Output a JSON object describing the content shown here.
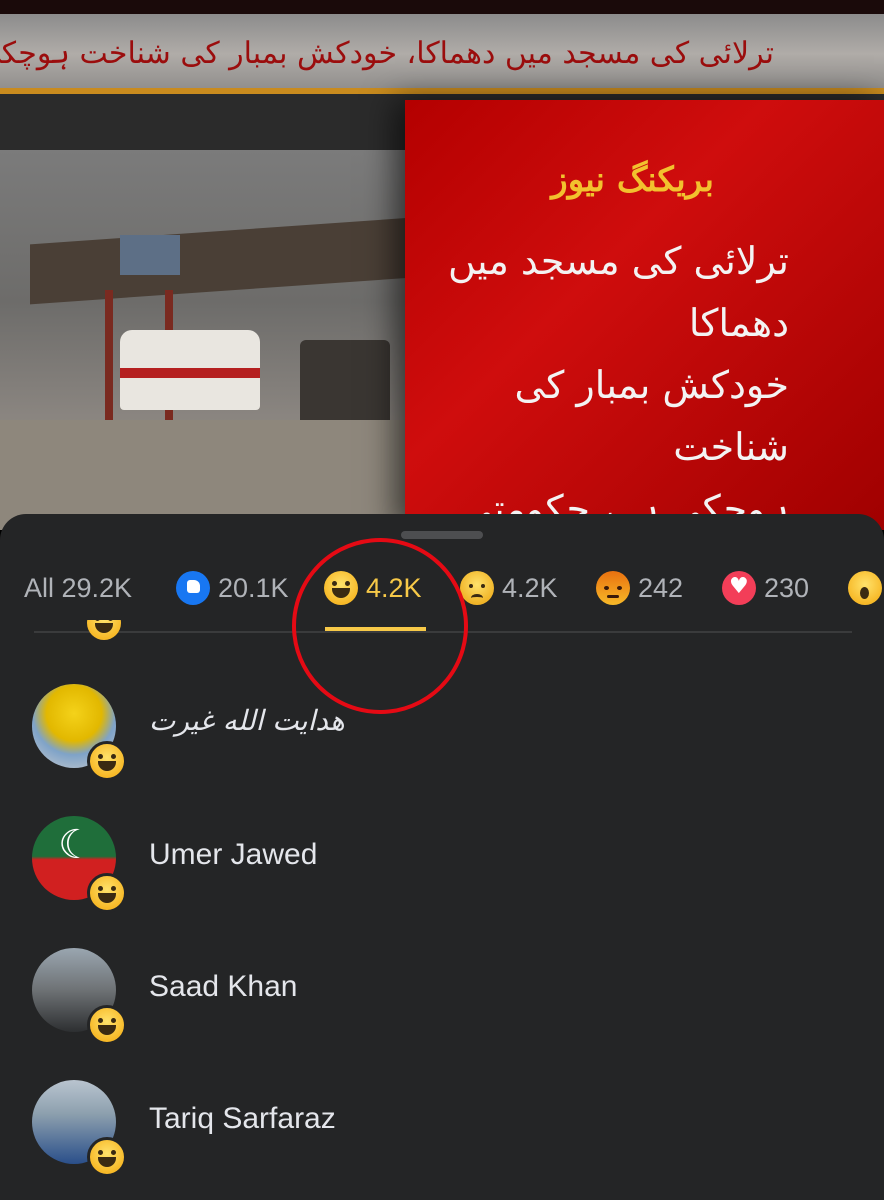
{
  "news": {
    "headline": "ترلائی کی مسجد میں دھماکا، خودکش بمبار کی شناخت ہوچکی ہے، حکومتی ذرائع",
    "breaking_label": "بریکنگ نیوز",
    "panel_lines": [
      "ترلائی کی مسجد میں دھماکا",
      "خودکش بمبار کی شناخت",
      "ہوچکی ہے، حکومتی ذرائع"
    ]
  },
  "reactions_tabs": [
    {
      "label": "All 29.2K"
    },
    {
      "icon": "like-icon",
      "count": "20.1K"
    },
    {
      "icon": "haha-icon",
      "count": "4.2K",
      "active": true
    },
    {
      "icon": "sad-icon",
      "count": "4.2K"
    },
    {
      "icon": "angry-icon",
      "count": "242"
    },
    {
      "icon": "love-icon",
      "count": "230"
    },
    {
      "icon": "wow-icon",
      "count": ""
    }
  ],
  "people": [
    {
      "name": "هدایت الله غیرت",
      "reaction": "haha-icon"
    },
    {
      "name": "Umer Jawed",
      "reaction": "haha-icon"
    },
    {
      "name": "Saad Khan",
      "reaction": "haha-icon"
    },
    {
      "name": "Tariq Sarfaraz",
      "reaction": "haha-icon"
    }
  ],
  "colors": {
    "sheet_bg": "#242526",
    "active_accent": "#f7c948",
    "annotation_circle": "#e50a14",
    "inactive_text": "#b0b3b8"
  }
}
